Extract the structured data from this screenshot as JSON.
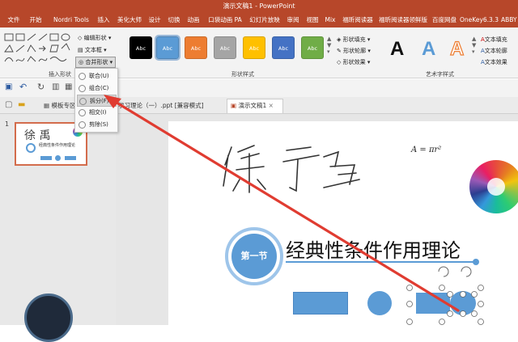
{
  "window": {
    "title": "演示文稿1 - PowerPoint"
  },
  "menu_tabs": [
    "文件",
    "开始",
    "Nordri Tools",
    "插入",
    "美化大师",
    "设计",
    "切换",
    "动画",
    "口袋动画 PA",
    "幻灯片放映",
    "审阅",
    "视图",
    "Mix",
    "福昕阅读器",
    "福昕阅读器领鲜版",
    "百度网盘",
    "OneKey6.3.3",
    "ABBY"
  ],
  "ribbon": {
    "insert_shapes": {
      "label": "插入形状",
      "edit_shape": "编辑形状",
      "text_box": "文本框",
      "merge_shapes": "合并形状"
    },
    "shape_styles": {
      "label": "形状样式",
      "swatch_text": "Abc",
      "swatch_colors": [
        "#000000",
        "#5b9bd5",
        "#ed7d31",
        "#a5a5a5",
        "#ffc000",
        "#4472c4",
        "#70ad47"
      ],
      "fill": "形状填充",
      "outline": "形状轮廓",
      "effects": "形状效果"
    },
    "wordart": {
      "label": "艺术字样式",
      "letters": [
        "A",
        "A",
        "A"
      ],
      "text_fill": "文本填充",
      "text_outline": "文本轮廓",
      "text_effects": "文本效果"
    }
  },
  "doc_tabs": {
    "template": "模板专区",
    "file1": "学习理论（一）.ppt [兼容模式]",
    "file2": "演示文稿1"
  },
  "dropdown": {
    "items": [
      "联合(U)",
      "组合(C)",
      "拆分(F)",
      "相交(I)",
      "剪除(S)"
    ],
    "highlighted": "拆分(F)"
  },
  "slide_panel": {
    "slide_number": "1",
    "thumb_title": "经典性条件作用理论"
  },
  "slide": {
    "handwriting": "徐 禹",
    "formula": "A = πr²",
    "badge": "第一节",
    "title": "经典性条件作用理论"
  },
  "colors": {
    "brand": "#b7472a",
    "accent_blue": "#5b9bd5",
    "arrow": "#e03c31"
  }
}
